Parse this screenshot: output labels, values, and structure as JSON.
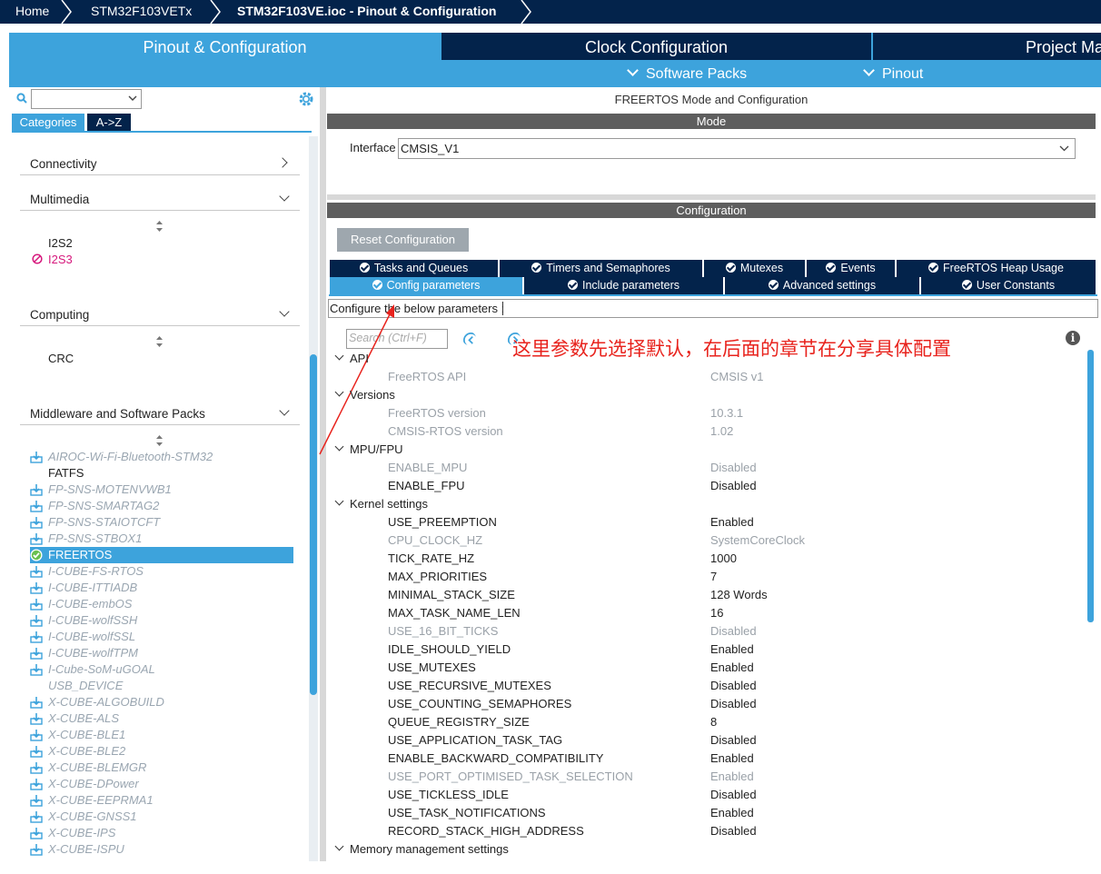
{
  "breadcrumbs": [
    "Home",
    "STM32F103VETx",
    "STM32F103VE.ioc - Pinout & Configuration"
  ],
  "main_tabs": [
    "Pinout & Configuration",
    "Clock Configuration",
    "Project Ma"
  ],
  "sub_tabs": [
    "Software Packs",
    "Pinout"
  ],
  "left": {
    "category_tabs": [
      "Categories",
      "A->Z"
    ],
    "sections": {
      "connectivity": "Connectivity",
      "multimedia": "Multimedia",
      "computing": "Computing",
      "middleware": "Middleware and Software Packs"
    },
    "multimedia_items": [
      "I2S2",
      "I2S3"
    ],
    "computing_items": [
      "CRC"
    ],
    "packs": [
      "AIROC-Wi-Fi-Bluetooth-STM32",
      "FATFS",
      "FP-SNS-MOTENVWB1",
      "FP-SNS-SMARTAG2",
      "FP-SNS-STAIOTCFT",
      "FP-SNS-STBOX1",
      "FREERTOS",
      "I-CUBE-FS-RTOS",
      "I-CUBE-ITTIADB",
      "I-CUBE-embOS",
      "I-CUBE-wolfSSH",
      "I-CUBE-wolfSSL",
      "I-CUBE-wolfTPM",
      "I-Cube-SoM-uGOAL",
      "USB_DEVICE",
      "X-CUBE-ALGOBUILD",
      "X-CUBE-ALS",
      "X-CUBE-BLE1",
      "X-CUBE-BLE2",
      "X-CUBE-BLEMGR",
      "X-CUBE-DPower",
      "X-CUBE-EEPRMA1",
      "X-CUBE-GNSS1",
      "X-CUBE-IPS",
      "X-CUBE-ISPU"
    ]
  },
  "right": {
    "title": "FREERTOS Mode and Configuration",
    "mode_bar": "Mode",
    "interface_label": "Interface",
    "interface_value": "CMSIS_V1",
    "config_bar": "Configuration",
    "reset_button": "Reset Configuration",
    "tabs_row1": [
      "Tasks and Queues",
      "Timers and Semaphores",
      "Mutexes",
      "Events",
      "FreeRTOS Heap Usage"
    ],
    "tabs_row2": [
      "Config parameters",
      "Include parameters",
      "Advanced settings",
      "User Constants"
    ],
    "configure_label": "Configure the below parameters :",
    "search_placeholder": "Search (Ctrl+F)",
    "annotation": "这里参数先选择默认，在后面的章节在分享具体配置",
    "info_glyph": "i",
    "groups": {
      "api": "API",
      "versions": "Versions",
      "mpu": "MPU/FPU",
      "kernel": "Kernel settings",
      "memory": "Memory management settings"
    },
    "params": [
      [
        "FreeRTOS API",
        "CMSIS v1"
      ],
      [
        "FreeRTOS version",
        "10.3.1"
      ],
      [
        "CMSIS-RTOS version",
        "1.02"
      ],
      [
        "ENABLE_MPU",
        "Disabled"
      ],
      [
        "ENABLE_FPU",
        "Disabled"
      ],
      [
        "USE_PREEMPTION",
        "Enabled"
      ],
      [
        "CPU_CLOCK_HZ",
        "SystemCoreClock"
      ],
      [
        "TICK_RATE_HZ",
        "1000"
      ],
      [
        "MAX_PRIORITIES",
        "7"
      ],
      [
        "MINIMAL_STACK_SIZE",
        "128 Words"
      ],
      [
        "MAX_TASK_NAME_LEN",
        "16"
      ],
      [
        "USE_16_BIT_TICKS",
        "Disabled"
      ],
      [
        "IDLE_SHOULD_YIELD",
        "Enabled"
      ],
      [
        "USE_MUTEXES",
        "Enabled"
      ],
      [
        "USE_RECURSIVE_MUTEXES",
        "Disabled"
      ],
      [
        "USE_COUNTING_SEMAPHORES",
        "Disabled"
      ],
      [
        "QUEUE_REGISTRY_SIZE",
        "8"
      ],
      [
        "USE_APPLICATION_TASK_TAG",
        "Disabled"
      ],
      [
        "ENABLE_BACKWARD_COMPATIBILITY",
        "Enabled"
      ],
      [
        "USE_PORT_OPTIMISED_TASK_SELECTION",
        "Enabled"
      ],
      [
        "USE_TICKLESS_IDLE",
        "Disabled"
      ],
      [
        "USE_TASK_NOTIFICATIONS",
        "Enabled"
      ],
      [
        "RECORD_STACK_HIGH_ADDRESS",
        "Disabled"
      ]
    ]
  },
  "colors": {
    "navy": "#03234b",
    "accent": "#3da3dc",
    "annotation": "#e8231d"
  }
}
